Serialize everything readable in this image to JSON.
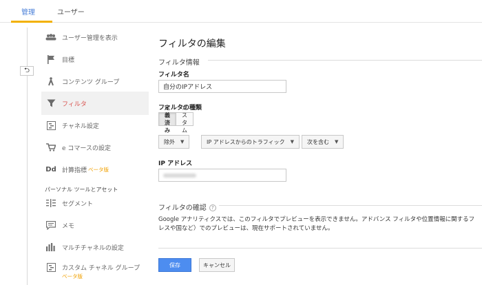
{
  "tabs": {
    "admin": "管理",
    "user": "ユーザー"
  },
  "sidebar": {
    "items": [
      {
        "label": "ユーザー管理を表示",
        "icon": "users-icon"
      },
      {
        "label": "目標",
        "icon": "flag-icon"
      },
      {
        "label": "コンテンツ グループ",
        "icon": "person-walk-icon"
      },
      {
        "label": "フィルタ",
        "icon": "filter-icon"
      },
      {
        "label": "チャネル設定",
        "icon": "channel-icon"
      },
      {
        "label": "e コマースの設定",
        "icon": "cart-icon"
      },
      {
        "label": "計算指標",
        "icon": "dd-icon",
        "beta": "ベータ版"
      },
      {
        "label": "セグメント",
        "icon": "segment-icon"
      },
      {
        "label": "メモ",
        "icon": "note-icon"
      },
      {
        "label": "マルチチャネルの設定",
        "icon": "bar-chart-icon"
      },
      {
        "label": "カスタム チャネル グループ",
        "icon": "channel-group-icon",
        "beta": "ベータ版"
      }
    ],
    "section_personal": "パーソナル ツールとアセット",
    "dd_glyph": "Dd"
  },
  "main": {
    "title": "フィルタの編集",
    "section_info": "フィルタ情報",
    "filter_name_label": "フィルタ名",
    "filter_name_value": "自分のIPアドレス",
    "filter_type_label": "フィルタの種類",
    "toggle_predefined": "定義済み",
    "toggle_custom": "カスタム",
    "dd_exclude": "除外",
    "dd_source": "IP アドレスからのトラフィック",
    "dd_match": "次を含む",
    "ip_label": "IP アドレス",
    "confirm_title": "フィルタの確認",
    "confirm_line1": "Google アナリティクスでは、このフィルタでプレビューを表示できません。アドバンス フィルタや位置情報に関するフ",
    "confirm_line2": "レスや国など）でのプレビューは、現在サポートされていません。",
    "save": "保存",
    "cancel": "キャンセル"
  },
  "colors": {
    "accent": "#4a7fd8",
    "tab_underline": "#f2b100",
    "selected_label": "#d9534f",
    "primary_button": "#4d8df0"
  }
}
